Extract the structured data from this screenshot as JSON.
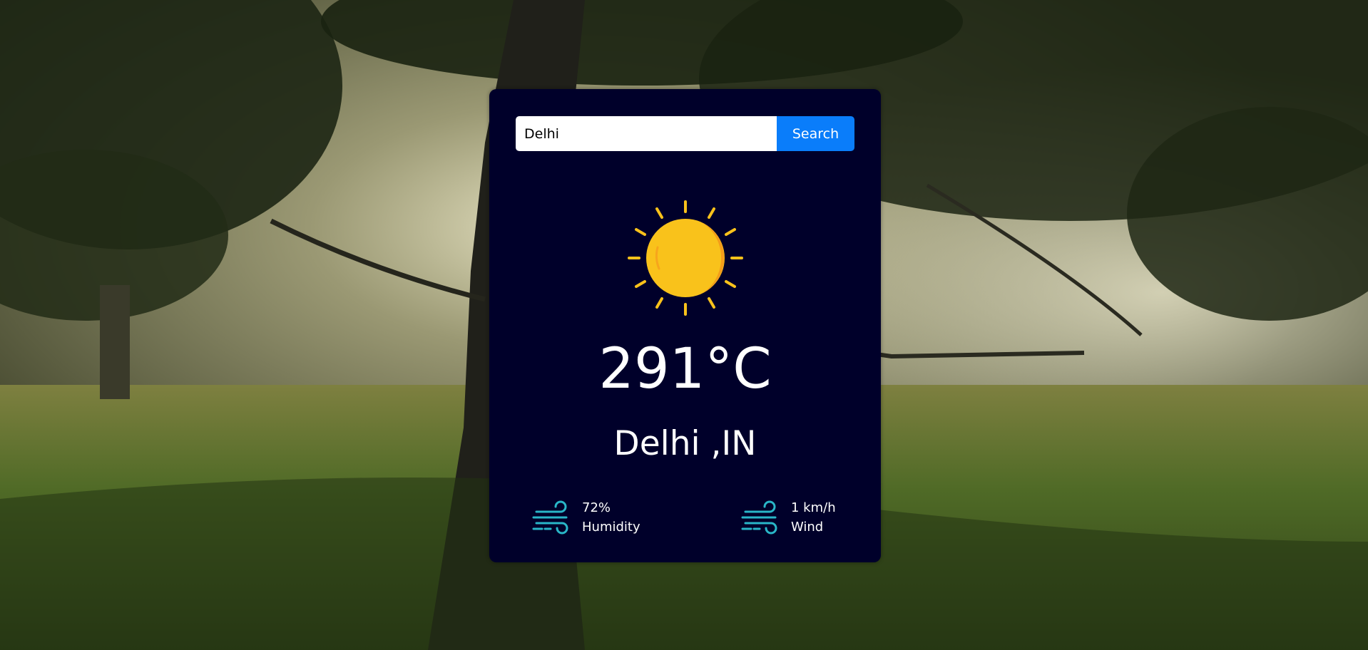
{
  "search": {
    "value": "Delhi",
    "button_label": "Search"
  },
  "weather": {
    "icon": "sun-icon",
    "temperature": "291°C",
    "location": "Delhi ,IN"
  },
  "stats": {
    "humidity": {
      "icon": "wind-icon",
      "value": "72%",
      "label": "Humidity"
    },
    "wind": {
      "icon": "wind-icon",
      "value": "1 km/h",
      "label": "Wind"
    }
  },
  "colors": {
    "card_bg": "#00002a",
    "button_bg": "#0a7dfa",
    "sun": "#f9c21b",
    "stat_icon": "#29b6c8"
  }
}
